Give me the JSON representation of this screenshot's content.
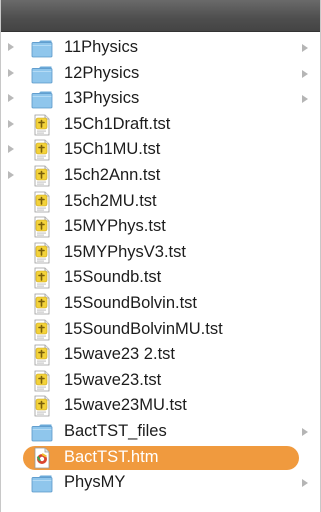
{
  "window": {
    "title": ""
  },
  "list": {
    "items": [
      {
        "name": "11Physics",
        "type": "folder",
        "outer_disclosure": true,
        "has_arrow": true,
        "selected": false
      },
      {
        "name": "12Physics",
        "type": "folder",
        "outer_disclosure": true,
        "has_arrow": true,
        "selected": false
      },
      {
        "name": "13Physics",
        "type": "folder",
        "outer_disclosure": true,
        "has_arrow": true,
        "selected": false
      },
      {
        "name": "15Ch1Draft.tst",
        "type": "tst",
        "outer_disclosure": true,
        "has_arrow": false,
        "selected": false
      },
      {
        "name": "15Ch1MU.tst",
        "type": "tst",
        "outer_disclosure": true,
        "has_arrow": false,
        "selected": false
      },
      {
        "name": "15ch2Ann.tst",
        "type": "tst",
        "outer_disclosure": true,
        "has_arrow": false,
        "selected": false
      },
      {
        "name": "15ch2MU.tst",
        "type": "tst",
        "outer_disclosure": false,
        "has_arrow": false,
        "selected": false
      },
      {
        "name": "15MYPhys.tst",
        "type": "tst",
        "outer_disclosure": false,
        "has_arrow": false,
        "selected": false
      },
      {
        "name": "15MYPhysV3.tst",
        "type": "tst",
        "outer_disclosure": false,
        "has_arrow": false,
        "selected": false
      },
      {
        "name": "15Soundb.tst",
        "type": "tst",
        "outer_disclosure": false,
        "has_arrow": false,
        "selected": false
      },
      {
        "name": "15SoundBolvin.tst",
        "type": "tst",
        "outer_disclosure": false,
        "has_arrow": false,
        "selected": false
      },
      {
        "name": "15SoundBolvinMU.tst",
        "type": "tst",
        "outer_disclosure": false,
        "has_arrow": false,
        "selected": false
      },
      {
        "name": "15wave23 2.tst",
        "type": "tst",
        "outer_disclosure": false,
        "has_arrow": false,
        "selected": false
      },
      {
        "name": "15wave23.tst",
        "type": "tst",
        "outer_disclosure": false,
        "has_arrow": false,
        "selected": false
      },
      {
        "name": "15wave23MU.tst",
        "type": "tst",
        "outer_disclosure": false,
        "has_arrow": false,
        "selected": false
      },
      {
        "name": "BactTST_files",
        "type": "folder",
        "outer_disclosure": false,
        "has_arrow": true,
        "selected": false
      },
      {
        "name": "BactTST.htm",
        "type": "htm",
        "outer_disclosure": false,
        "has_arrow": false,
        "selected": true
      },
      {
        "name": "PhysMY",
        "type": "folder",
        "outer_disclosure": false,
        "has_arrow": true,
        "selected": false
      }
    ]
  },
  "colors": {
    "selection": "#f09a3e",
    "folder_body": "#8fc6ec",
    "folder_tab": "#6aa9d8",
    "tst_icon": "#f3d23a",
    "text": "#1c1c1c"
  },
  "icons": {
    "folder": "folder-icon",
    "tst": "tst-document-icon",
    "htm": "html-document-icon",
    "disclosure": "disclosure-triangle-icon",
    "arrow": "column-arrow-icon"
  }
}
